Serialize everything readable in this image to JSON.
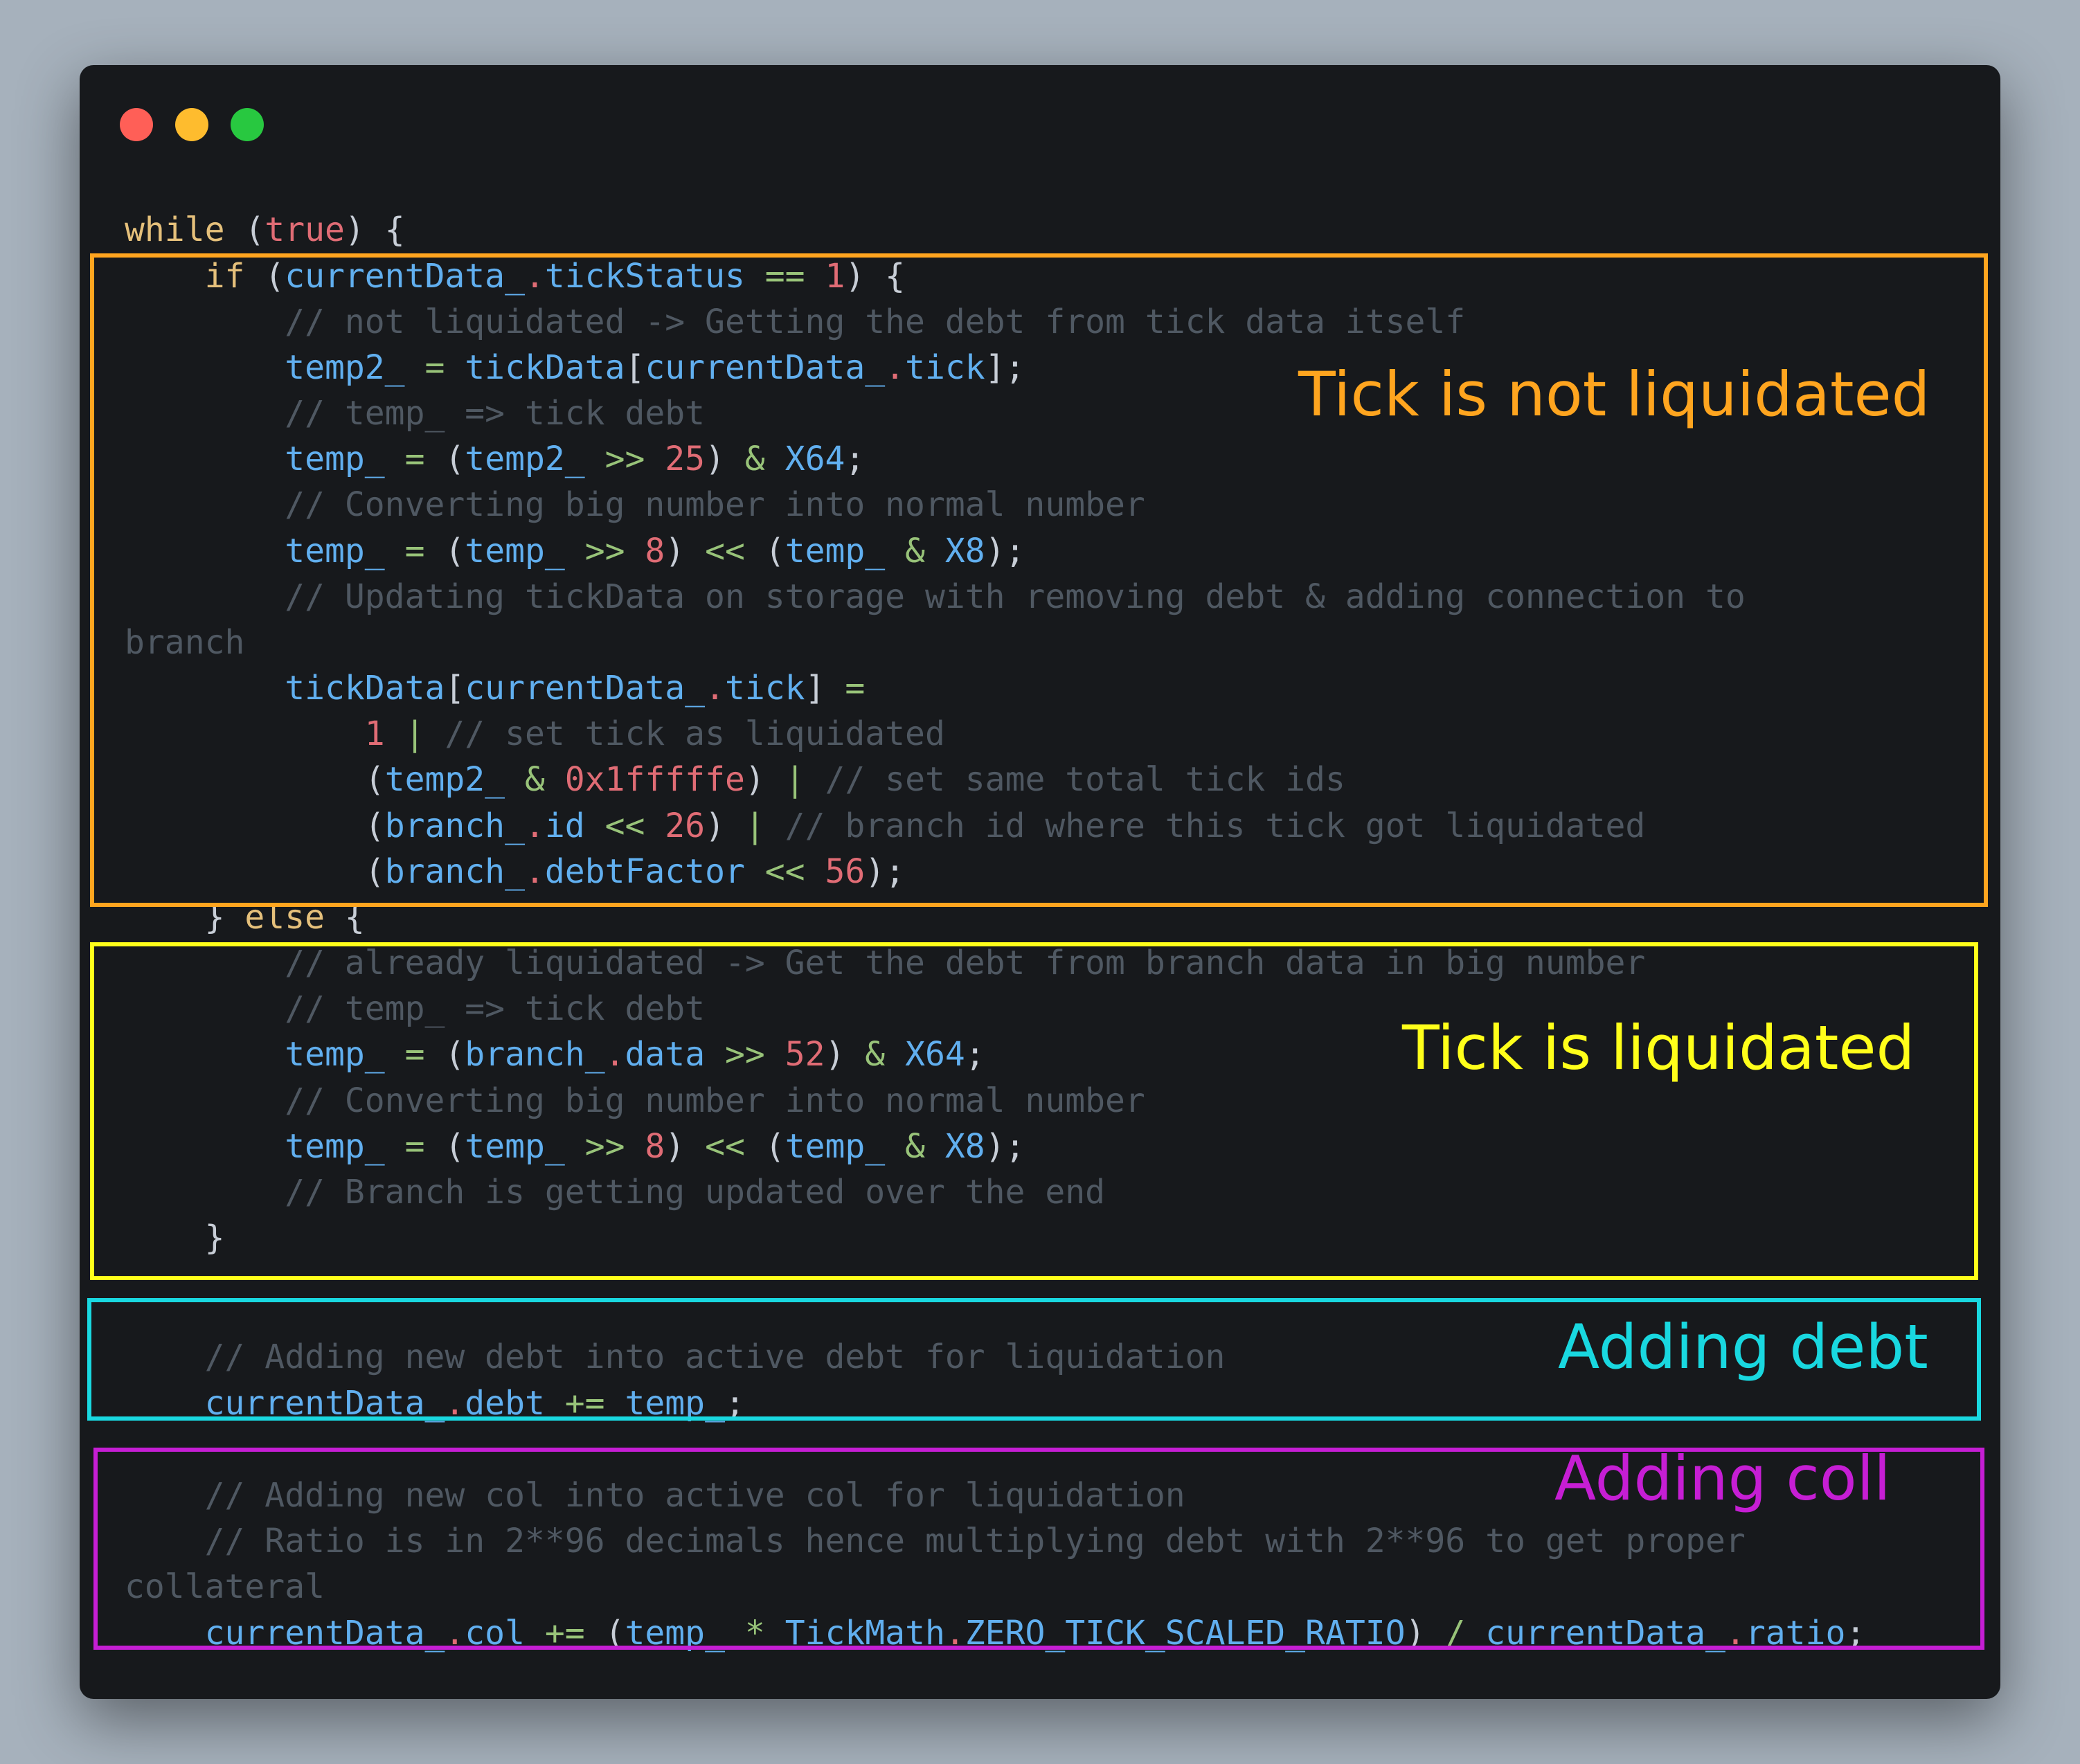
{
  "colors": {
    "background": "#a6b1bc",
    "window": "#17191c",
    "traffic_red": "#ff5f57",
    "traffic_yellow": "#febc2e",
    "traffic_green": "#28c840",
    "not_liquidated": "#ffa51f",
    "liquidated": "#ffff1a",
    "adding_debt": "#19d8e0",
    "adding_coll": "#c61ed4"
  },
  "code": {
    "l1": {
      "kw": "while",
      "a": " (",
      "b": "true",
      "c": ") {"
    },
    "l2": {
      "kw": "if",
      "a": " (",
      "b": "currentData_",
      "c": ".",
      "d": "tickStatus",
      "e": " == ",
      "f": "1",
      "g": ") {"
    },
    "l3": {
      "cm": "// not liquidated -> Getting the debt from tick data itself"
    },
    "l4": {
      "a": "temp2_",
      "b": " = ",
      "c": "tickData",
      "d": "[",
      "e": "currentData_",
      "f": ".",
      "g": "tick",
      "h": "];"
    },
    "l5": {
      "cm": "// temp_ => tick debt"
    },
    "l6": {
      "a": "temp_",
      "b": " = ",
      "c": "(",
      "d": "temp2_",
      "e": " >> ",
      "f": "25",
      "g": ") ",
      "h": "&",
      "i": " ",
      "j": "X64",
      "k": ";"
    },
    "l7": {
      "cm": "// Converting big number into normal number"
    },
    "l8": {
      "a": "temp_",
      "b": " = ",
      "c": "(",
      "d": "temp_",
      "e": " >> ",
      "f": "8",
      "g": ") ",
      "h": "<<",
      "i": " (",
      "j": "temp_",
      "k": " & ",
      "l": "X8",
      "m": ");"
    },
    "l9": {
      "cm": "// Updating tickData on storage with removing debt & adding connection to"
    },
    "l10": {
      "cm": "branch"
    },
    "l11": {
      "a": "tickData",
      "b": "[",
      "c": "currentData_",
      "d": ".",
      "e": "tick",
      "f": "] ",
      "g": "="
    },
    "l12": {
      "a": "1",
      "b": " | ",
      "cm": "// set tick as liquidated"
    },
    "l13": {
      "a": "(",
      "b": "temp2_",
      "c": " & ",
      "d": "0x1fffffe",
      "e": ") ",
      "f": "|",
      "cm": " // set same total tick ids"
    },
    "l14": {
      "a": "(",
      "b": "branch_",
      "c": ".",
      "d": "id",
      "e": " << ",
      "f": "26",
      "g": ") ",
      "h": "|",
      "cm": " // branch id where this tick got liquidated"
    },
    "l15": {
      "a": "(",
      "b": "branch_",
      "c": ".",
      "d": "debtFactor",
      "e": " << ",
      "f": "56",
      "g": ");"
    },
    "l16": {
      "a": "} ",
      "kw": "else",
      "b": " {"
    },
    "l17": {
      "cm": "// already liquidated -> Get the debt from branch data in big number"
    },
    "l18": {
      "cm": "// temp_ => tick debt"
    },
    "l19": {
      "a": "temp_",
      "b": " = ",
      "c": "(",
      "d": "branch_",
      "e": ".",
      "f": "data",
      "g": " >> ",
      "h": "52",
      "i": ") ",
      "j": "&",
      "k": " ",
      "l": "X64",
      "m": ";"
    },
    "l20": {
      "cm": "// Converting big number into normal number"
    },
    "l21": {
      "a": "temp_",
      "b": " = ",
      "c": "(",
      "d": "temp_",
      "e": " >> ",
      "f": "8",
      "g": ") ",
      "h": "<<",
      "i": " (",
      "j": "temp_",
      "k": " & ",
      "l": "X8",
      "m": ");"
    },
    "l22": {
      "cm": "// Branch is getting updated over the end"
    },
    "l23": {
      "a": "}"
    },
    "l24": {
      "cm": "// Adding new debt into active debt for liquidation"
    },
    "l25": {
      "a": "currentData_",
      "b": ".",
      "c": "debt",
      "d": " += ",
      "e": "temp_",
      "f": ";"
    },
    "l26": {
      "cm": "// Adding new col into active col for liquidation"
    },
    "l27": {
      "cm": "// Ratio is in 2**96 decimals hence multiplying debt with 2**96 to get proper"
    },
    "l28": {
      "cm": "collateral"
    },
    "l29": {
      "a": "currentData_",
      "b": ".",
      "c": "col",
      "d": " += ",
      "e": "(",
      "f": "temp_",
      "g": " * ",
      "h": "TickMath",
      "i": ".",
      "j": "ZERO_TICK_SCALED_RATIO",
      "k": ") ",
      "l": "/",
      "m": " ",
      "n": "currentData_",
      "o": ".",
      "p": "ratio",
      "q": ";"
    }
  },
  "annotations": {
    "not_liquidated": "Tick is not liquidated",
    "liquidated": "Tick is liquidated",
    "adding_debt": "Adding debt",
    "adding_coll": "Adding coll"
  }
}
